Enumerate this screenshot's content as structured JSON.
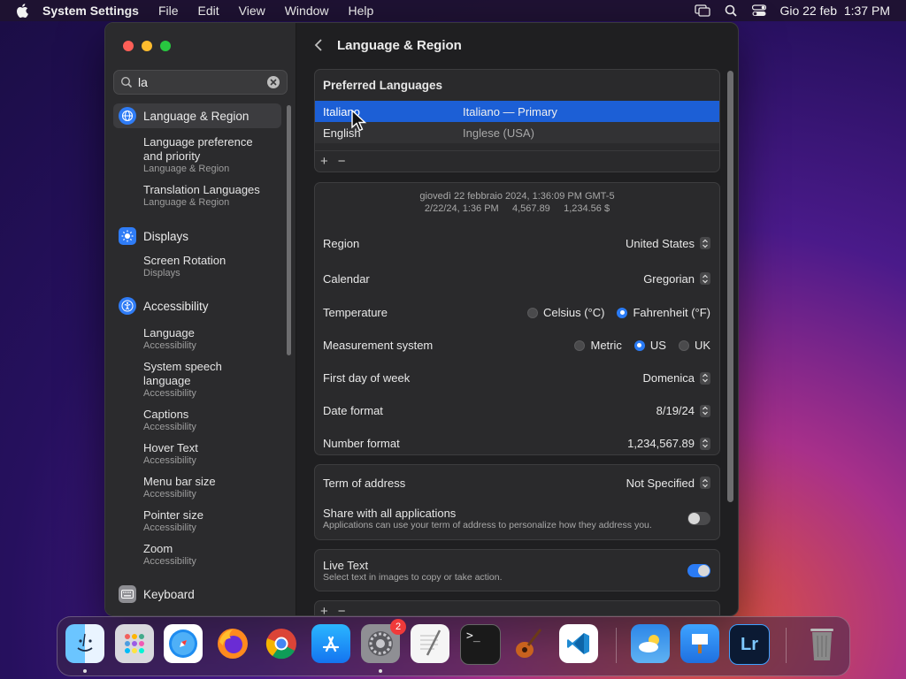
{
  "menubar": {
    "app": "System Settings",
    "menus": [
      "File",
      "Edit",
      "View",
      "Window",
      "Help"
    ],
    "datetime": "Gio 22 feb  1:37 PM"
  },
  "sidebar": {
    "search_value": "la",
    "items": [
      {
        "label": "Language & Region",
        "icon": "globe-icon",
        "subs": [
          {
            "title": "Language preference and priority",
            "section": "Language & Region"
          },
          {
            "title": "Translation Languages",
            "section": "Language & Region"
          }
        ]
      },
      {
        "label": "Displays",
        "icon": "sun-icon",
        "subs": [
          {
            "title": "Screen Rotation",
            "section": "Displays"
          }
        ]
      },
      {
        "label": "Accessibility",
        "icon": "accessibility-icon",
        "subs": [
          {
            "title": "Language",
            "section": "Accessibility"
          },
          {
            "title": "System speech language",
            "section": "Accessibility"
          },
          {
            "title": "Captions",
            "section": "Accessibility"
          },
          {
            "title": "Hover Text",
            "section": "Accessibility"
          },
          {
            "title": "Menu bar size",
            "section": "Accessibility"
          },
          {
            "title": "Pointer size",
            "section": "Accessibility"
          },
          {
            "title": "Zoom",
            "section": "Accessibility"
          }
        ]
      },
      {
        "label": "Keyboard",
        "icon": "keyboard-icon"
      }
    ]
  },
  "content": {
    "title": "Language & Region",
    "preferred": {
      "header": "Preferred Languages",
      "languages": [
        {
          "name": "Italiano",
          "desc": "Italiano — Primary"
        },
        {
          "name": "English",
          "desc": "Inglese (USA)"
        }
      ],
      "add": "+",
      "remove": "−"
    },
    "preview": {
      "line1": "giovedì 22 febbraio 2024, 1:36:09 PM GMT-5",
      "line2": "2/22/24, 1:36 PM     4,567.89     1,234.56 $"
    },
    "region": {
      "label": "Region",
      "value": "United States"
    },
    "calendar": {
      "label": "Calendar",
      "value": "Gregorian"
    },
    "temperature": {
      "label": "Temperature",
      "options": [
        "Celsius (°C)",
        "Fahrenheit (°F)"
      ],
      "selected": "Fahrenheit (°F)"
    },
    "measurement": {
      "label": "Measurement system",
      "options": [
        "Metric",
        "US",
        "UK"
      ],
      "selected": "US"
    },
    "first_day": {
      "label": "First day of week",
      "value": "Domenica"
    },
    "date_format": {
      "label": "Date format",
      "value": "8/19/24"
    },
    "number_format": {
      "label": "Number format",
      "value": "1,234,567.89"
    },
    "term": {
      "label": "Term of address",
      "value": "Not Specified"
    },
    "share": {
      "label": "Share with all applications",
      "desc": "Applications can use your term of address to personalize how they address you.",
      "on": false
    },
    "live_text": {
      "label": "Live Text",
      "desc": "Select text in images to copy or take action.",
      "on": true
    }
  },
  "dock": {
    "apps": [
      "Finder",
      "Launchpad",
      "Safari",
      "Firefox",
      "Chrome",
      "App Store",
      "System Settings",
      "TextEdit",
      "Terminal",
      "GarageBand",
      "Visual Studio Code",
      "Weather",
      "Keynote",
      "Lightroom",
      "Trash"
    ],
    "settings_badge": "2"
  },
  "colors": {
    "accent": "#1c5fd6",
    "toggle_on": "#2a7bf5"
  }
}
